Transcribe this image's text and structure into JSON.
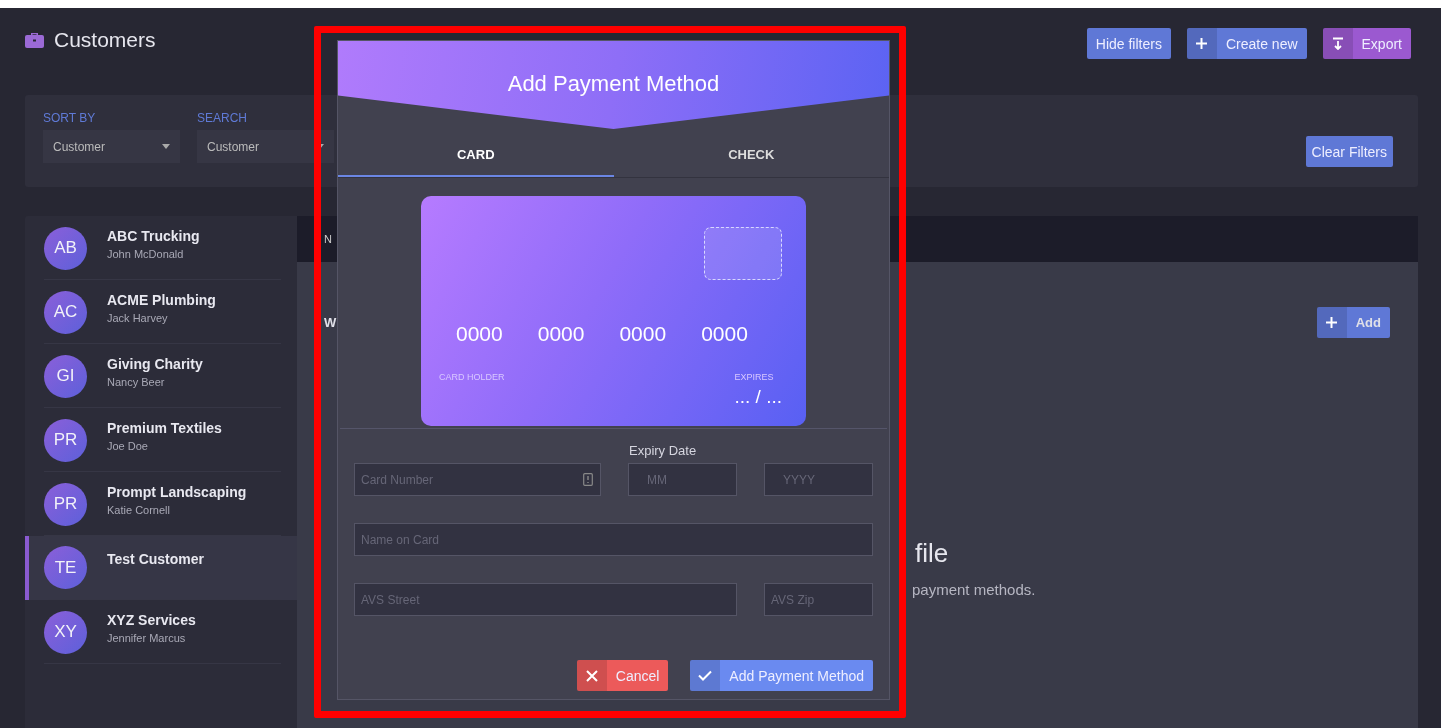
{
  "page": {
    "title": "Customers"
  },
  "toolbar": {
    "buttons": [
      {
        "label": "Hide filters",
        "kind": "plain"
      },
      {
        "label": "Create new",
        "kind": "create"
      },
      {
        "label": "Export",
        "kind": "export"
      }
    ]
  },
  "filters": {
    "sort_by": {
      "label": "SORT BY",
      "value": "Customer"
    },
    "search": {
      "label": "SEARCH",
      "value": "Customer"
    },
    "clear_button": "Clear Filters"
  },
  "customers": [
    {
      "initials": "AB",
      "name": "ABC Trucking",
      "contact": "John McDonald",
      "selected": false
    },
    {
      "initials": "AC",
      "name": "ACME Plumbing",
      "contact": "Jack Harvey",
      "selected": false
    },
    {
      "initials": "GI",
      "name": "Giving Charity",
      "contact": "Nancy Beer",
      "selected": false
    },
    {
      "initials": "PR",
      "name": "Premium Textiles",
      "contact": "Joe Doe",
      "selected": false
    },
    {
      "initials": "PR",
      "name": "Prompt Landscaping",
      "contact": "Katie Cornell",
      "selected": false
    },
    {
      "initials": "TE",
      "name": "Test Customer",
      "selected": true
    },
    {
      "initials": "XY",
      "name": "XYZ Services",
      "contact": "Jennifer Marcus",
      "selected": false
    }
  ],
  "detail": {
    "tab_fragment": "N",
    "heading_fragment": "W",
    "add_button": "Add",
    "empty_title_fragment": "file",
    "empty_text_fragment": "payment methods."
  },
  "modal": {
    "title": "Add Payment Method",
    "tabs": [
      {
        "label": "CARD",
        "selected": true
      },
      {
        "label": "CHECK",
        "selected": false
      }
    ],
    "card_preview": {
      "number_groups": [
        "0000",
        "0000",
        "0000",
        "0000"
      ],
      "holder_label": "CARD HOLDER",
      "expires_label": "EXPIRES",
      "expires_value": "... / ..."
    },
    "expiry_label": "Expiry Date",
    "fields": [
      {
        "placeholder": "Card Number",
        "kind": "card-number"
      },
      {
        "placeholder": "MM",
        "kind": "month"
      },
      {
        "placeholder": "YYYY",
        "kind": "year"
      },
      {
        "placeholder": "Name on Card",
        "kind": "wide"
      },
      {
        "placeholder": "AVS Street",
        "kind": "street"
      },
      {
        "placeholder": "AVS Zip",
        "kind": "zip"
      }
    ],
    "buttons": [
      {
        "label": "Cancel",
        "kind": "cancel"
      },
      {
        "label": "Add Payment Method",
        "kind": "confirm"
      }
    ]
  }
}
